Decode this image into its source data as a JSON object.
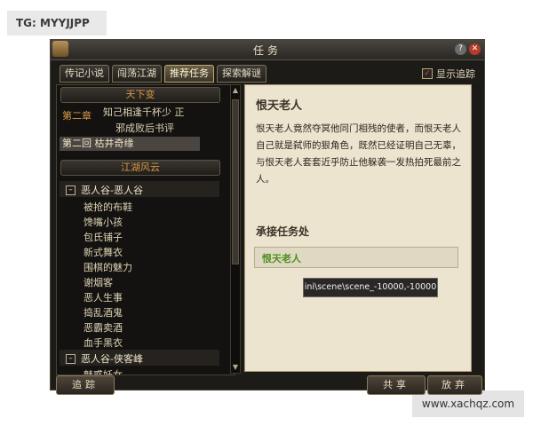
{
  "watermarks": {
    "top": "TG: MYYJJPP",
    "bottom": "www.xachqz.com"
  },
  "window": {
    "title": "任务"
  },
  "tabs": [
    {
      "label": "传记小说"
    },
    {
      "label": "闯荡江湖"
    },
    {
      "label": "推荐任务",
      "active": true
    },
    {
      "label": "探索解谜"
    }
  ],
  "show_track": {
    "label": "显示追踪",
    "checked": true
  },
  "left": {
    "section1": "天下变",
    "chapter": "第二章",
    "chapter_lines": [
      "知己相逢千杯少 正",
      "邪成败后书评"
    ],
    "selected": "第二回 枯井奇缘",
    "section2": "江湖风云",
    "groups": [
      {
        "name": "恶人谷-恶人谷",
        "items": [
          "被抢的布鞋",
          "馋嘴小孩",
          "包氏铺子",
          "新式舞衣",
          "围棋的魅力",
          "谢烟客",
          "恶人生事",
          "捣乱酒鬼",
          "恶霸卖酒",
          "血手黑衣"
        ]
      },
      {
        "name": "恶人谷-侠客峰",
        "items": [
          "魅惑妖女"
        ]
      }
    ]
  },
  "right": {
    "title": "恨天老人",
    "description": "恨天老人竟然夺冥他同门相残的使者，而恨天老人自己就是弑师的狠角色，既然已经证明自己无辜，与恨天老人套套近乎防止他躲袭一发热拍死最前之人。",
    "section": "承接任务处",
    "npc_link": "恨天老人",
    "tooltip": "ini\\scene\\scene_-10000,-10000"
  },
  "buttons": {
    "track": "追踪",
    "share": "共享",
    "abandon": "放弃"
  },
  "colors": {
    "accent": "#d79742",
    "link": "#4e8f1e",
    "close": "#b73a2a"
  }
}
